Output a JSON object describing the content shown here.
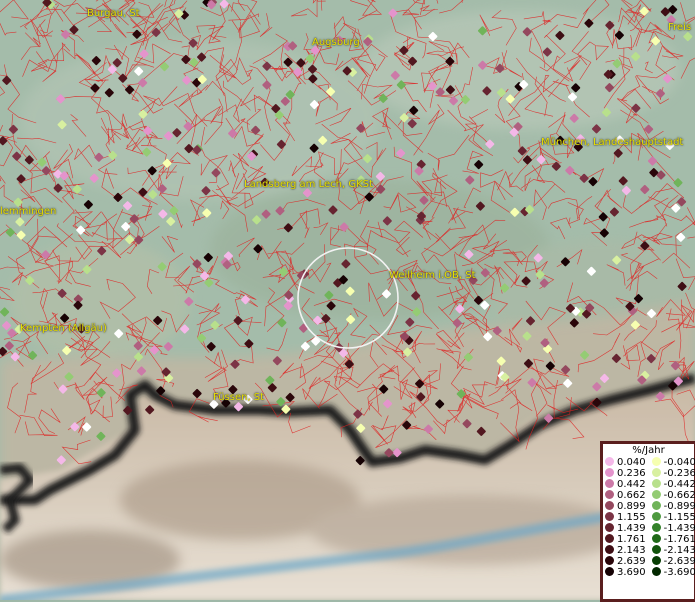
{
  "labels": {
    "burgau": "Burgau, St",
    "augsburg": "Augsburg",
    "freising": "Freis",
    "muenchen": "München, Landeshauptstadt",
    "landsberg": "Landsberg am Lech, GKSt",
    "memmingen": "lemmingen",
    "weilheim": "Weilheim i.OB, St",
    "kempten": "Kempten (Allgäu)",
    "fuessen": "Füssen, St"
  },
  "legend": {
    "title": "%/Jahr",
    "positive": [
      "0.040",
      "0.236",
      "0.442",
      "0.662",
      "0.899",
      "1.155",
      "1.439",
      "1.761",
      "2.143",
      "2.639",
      "3.690"
    ],
    "negative": [
      "-0.040",
      "-0.236",
      "-0.442",
      "-0.662",
      "-0.899",
      "-1.155",
      "-1.439",
      "-1.761",
      "-2.143",
      "-2.639",
      "-3.690"
    ],
    "positive_colors": [
      "#f4b8e8",
      "#e494cc",
      "#cc7aa8",
      "#b06080",
      "#94485e",
      "#7c3446",
      "#662430",
      "#521820",
      "#3e0e14",
      "#2a060a",
      "#160204"
    ],
    "negative_colors": [
      "#f6ffb0",
      "#d8f0a0",
      "#b8e08c",
      "#94cc74",
      "#70b45a",
      "#4e9a40",
      "#34822a",
      "#206a18",
      "#12540c",
      "#083e04",
      "#022800"
    ]
  }
}
